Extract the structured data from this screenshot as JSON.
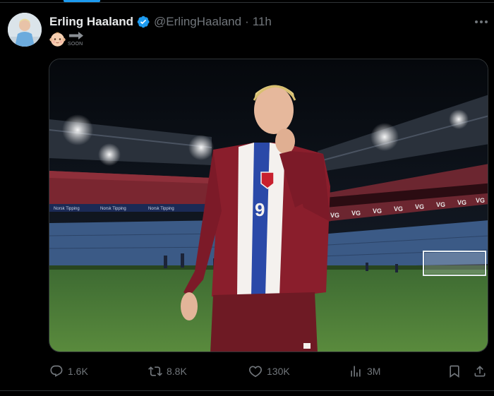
{
  "tweet": {
    "author": {
      "display_name": "Erling Haaland",
      "handle": "@ErlingHaaland",
      "verified": true
    },
    "separator": "·",
    "time": "11h",
    "text": {
      "emoji": "baby-face",
      "soon_label": "SOON"
    },
    "media": {
      "jersey_number": "9",
      "stadium_banner": "VG",
      "ad_text": "Norsk Tipping"
    }
  },
  "actions": {
    "reply": "1.6K",
    "retweet": "8.8K",
    "like": "130K",
    "views": "3M"
  },
  "colors": {
    "accent": "#1d9bf0",
    "muted": "#71767b",
    "text": "#e7e9ea",
    "background": "#000000"
  }
}
